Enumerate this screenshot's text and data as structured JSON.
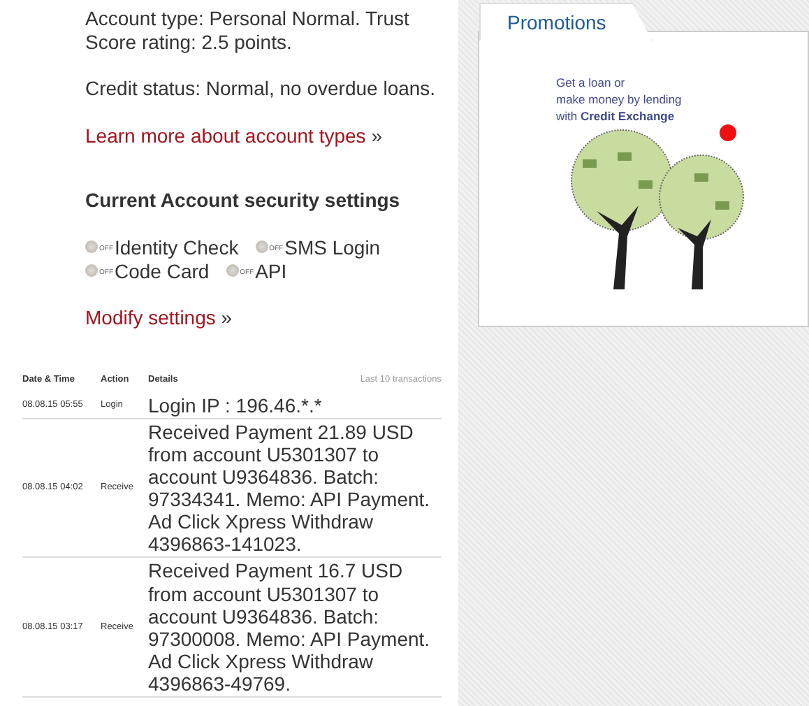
{
  "account_info": [
    "Account type: Personal Normal. Trust Score rating: 2.5 points.",
    "Credit status: Normal, no overdue loans."
  ],
  "account_link": {
    "label": "Learn more about account types",
    "suffix": "»"
  },
  "security": {
    "heading": "Current Account security settings",
    "items": [
      {
        "label": "Identity Check",
        "state_label": "OFF",
        "on": false
      },
      {
        "label": "SMS Login",
        "state_label": "OFF",
        "on": false
      },
      {
        "label": "Code Card",
        "state_label": "OFF",
        "on": false
      },
      {
        "label": "API",
        "state_label": "OFF",
        "on": false
      }
    ],
    "link": {
      "label": "Modify settings",
      "suffix": "»"
    }
  },
  "table": {
    "columns": [
      "Date & Time",
      "Action",
      "Details"
    ],
    "caption": "Last 10 transactions",
    "rows": [
      {
        "date": "08.08.15 05:55",
        "action": "Login",
        "details": "Login IP : 196.46.*.*"
      },
      {
        "date": "08.08.15 04:02",
        "action": "Receive",
        "details": "Received Payment 21.89 USD from account U5301307 to account U9364836. Batch: 97334341. Memo: API Payment. Ad Click Xpress Withdraw 4396863-141023."
      },
      {
        "date": "08.08.15 03:17",
        "action": "Receive",
        "details": "Received Payment 16.7 USD from account U5301307 to account U9364836. Batch: 97300008. Memo: API Payment. Ad Click Xpress Withdraw 4396863-49769."
      }
    ]
  },
  "promotions": {
    "tab": "Promotions",
    "banner_lines": [
      "Get a loan or",
      "make money by lending",
      "with **Credit Exchange**"
    ]
  }
}
